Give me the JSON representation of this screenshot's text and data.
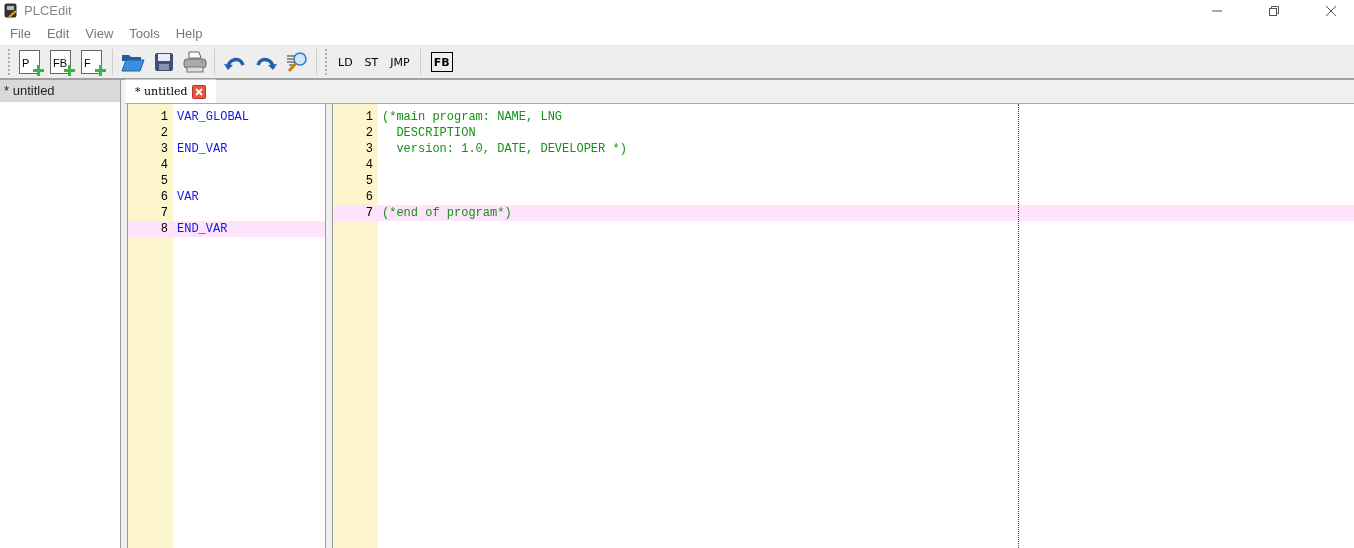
{
  "window": {
    "title": "PLCEdit"
  },
  "menu": [
    "File",
    "Edit",
    "View",
    "Tools",
    "Help"
  ],
  "toolbar": {
    "new_buttons": [
      {
        "label": "P"
      },
      {
        "label": "FB"
      },
      {
        "label": "F"
      }
    ],
    "language_buttons": [
      {
        "label": "LD",
        "kind": "plain"
      },
      {
        "label": "ST",
        "kind": "plain"
      },
      {
        "label": "JMP",
        "kind": "plain"
      },
      {
        "label": "FB",
        "kind": "boxed"
      }
    ]
  },
  "sidebar": {
    "items": [
      {
        "label": "* untitled",
        "selected": true
      }
    ]
  },
  "tabs": [
    {
      "label": "* untitled",
      "selected": true
    }
  ],
  "declarations_editor": {
    "lines": [
      {
        "number": "1",
        "text": "VAR_GLOBAL",
        "kind": "keyword",
        "current": false
      },
      {
        "number": "2",
        "current": false
      },
      {
        "number": "3",
        "text": "END_VAR",
        "kind": "keyword",
        "current": false
      },
      {
        "number": "4",
        "current": false
      },
      {
        "number": "5",
        "current": false
      },
      {
        "number": "6",
        "text": "VAR",
        "kind": "keyword",
        "current": false
      },
      {
        "number": "7",
        "current": false
      },
      {
        "number": "8",
        "text": "END_VAR",
        "kind": "keyword",
        "current": true
      }
    ]
  },
  "code_editor": {
    "lines": [
      {
        "number": "1",
        "text": "(*main program: NAME, LNG",
        "kind": "comment",
        "current": false
      },
      {
        "number": "2",
        "text": "  DESCRIPTION",
        "kind": "comment",
        "current": false
      },
      {
        "number": "3",
        "text": "  version: 1.0, DATE, DEVELOPER *)",
        "kind": "comment",
        "current": false
      },
      {
        "number": "4",
        "current": false
      },
      {
        "number": "5",
        "current": false
      },
      {
        "number": "6",
        "current": false
      },
      {
        "number": "7",
        "text": "(*end of program*)",
        "kind": "comment",
        "current": true
      }
    ]
  }
}
